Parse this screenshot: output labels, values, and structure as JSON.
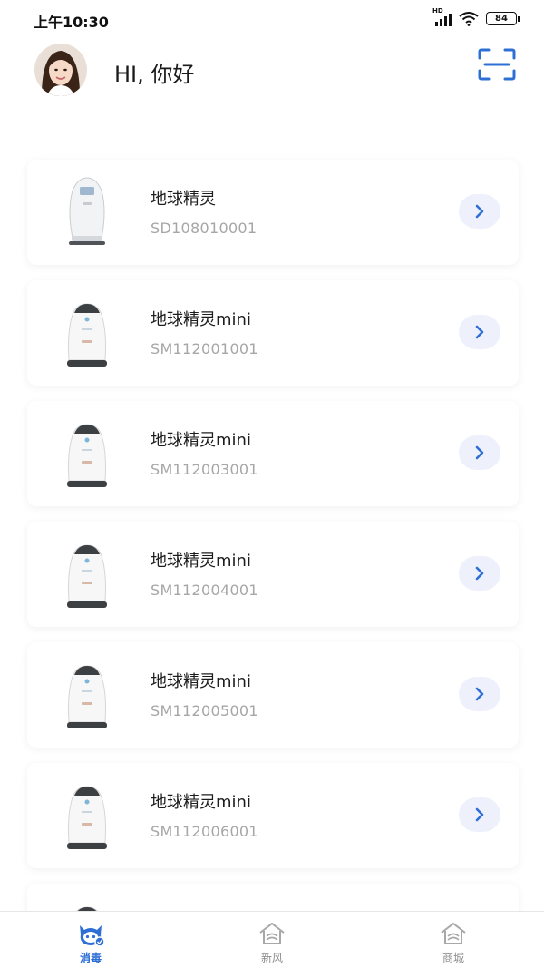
{
  "status_bar": {
    "time": "上午10:30",
    "network": "HD",
    "battery": "84"
  },
  "header": {
    "greeting": "HI, 你好"
  },
  "devices": [
    {
      "name": "地球精灵",
      "serial": "SD108010001"
    },
    {
      "name": "地球精灵mini",
      "serial": "SM112001001"
    },
    {
      "name": "地球精灵mini",
      "serial": "SM112003001"
    },
    {
      "name": "地球精灵mini",
      "serial": "SM112004001"
    },
    {
      "name": "地球精灵mini",
      "serial": "SM112005001"
    },
    {
      "name": "地球精灵mini",
      "serial": "SM112006001"
    }
  ],
  "tabbar": {
    "tabs": [
      {
        "label": "消毒",
        "icon": "disinfect-icon",
        "active": true
      },
      {
        "label": "新风",
        "icon": "fresh-air-house-icon",
        "active": false
      },
      {
        "label": "商城",
        "icon": "mall-house-icon",
        "active": false
      }
    ]
  },
  "colors": {
    "accent": "#2e6fd6",
    "arrow_bg": "#eef1fb",
    "serial_text": "#a6a6a6"
  }
}
